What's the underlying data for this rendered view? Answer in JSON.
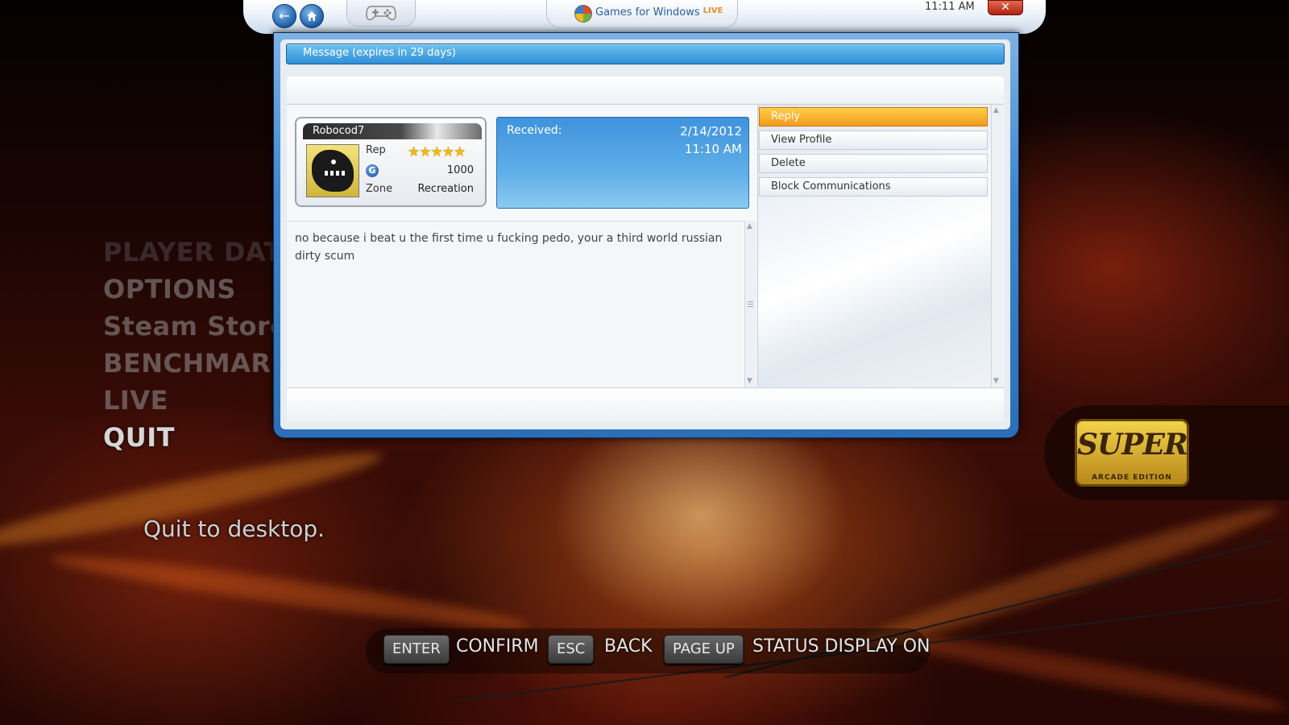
{
  "game_menu": {
    "items": [
      {
        "label": "PLAYER DATA"
      },
      {
        "label": "OPTIONS"
      },
      {
        "label": "Steam Store"
      },
      {
        "label": "BENCHMARK"
      },
      {
        "label": "LIVE"
      },
      {
        "label": "QUIT"
      }
    ],
    "description": "Quit to desktop."
  },
  "logo": {
    "text": "SUPER",
    "subtext": "ARCADE EDITION"
  },
  "hints": [
    {
      "key": "ENTER",
      "label": "CONFIRM"
    },
    {
      "key": "ESC",
      "label": "BACK"
    },
    {
      "key": "PAGE UP",
      "label": "STATUS DISPLAY ON"
    }
  ],
  "topbar": {
    "back_icon": "back-arrow-icon",
    "home_icon": "home-icon",
    "controller_icon": "controller-icon",
    "brand_games": "Games",
    "brand_for_windows": " for Windows",
    "brand_live": "LIVE",
    "clock": "11:11 AM",
    "close_label": "✕"
  },
  "message": {
    "title": "Message (expires in 29 days)",
    "sender": {
      "gamertag": "Robocod7",
      "rep_label": "Rep",
      "rep_stars": 5,
      "gamerscore": "1000",
      "zone_label": "Zone",
      "zone": "Recreation"
    },
    "received_label": "Received:",
    "received_date": "2/14/2012",
    "received_time": "11:10 AM",
    "body": "no because i beat u the first time u fucking pedo, your a third world russian dirty scum"
  },
  "actions": [
    {
      "label": "Reply",
      "selected": true
    },
    {
      "label": "View Profile",
      "selected": false
    },
    {
      "label": "Delete",
      "selected": false
    },
    {
      "label": "Block Communications",
      "selected": false
    }
  ],
  "colors": {
    "accent_blue": "#2f8fd6",
    "selected_orange": "#f39a1c"
  }
}
